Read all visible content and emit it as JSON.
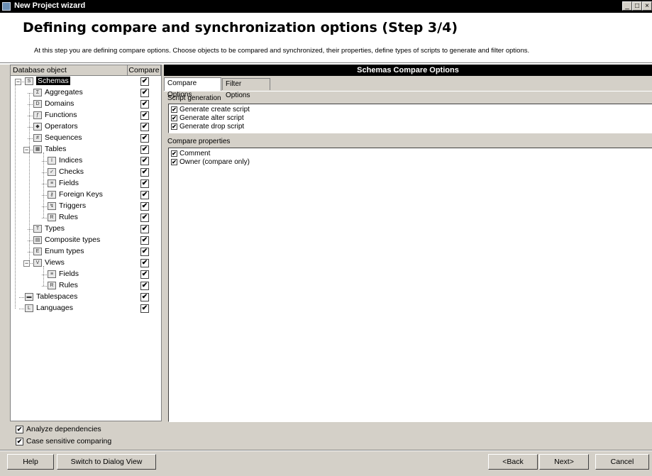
{
  "window": {
    "title": "New Project wizard",
    "controls": [
      "_",
      "□",
      "×"
    ]
  },
  "header": {
    "title": "Defining compare and synchronization options (Step 3/4)",
    "description": "At this step you are defining compare options. Choose objects to be compared and synchronized, their properties, define types of scripts to generate and filter options."
  },
  "tree": {
    "columns": {
      "object": "Database object",
      "compare": "Compare"
    },
    "items": [
      {
        "label": "Schemas",
        "icon": "schema-icon",
        "level": 0,
        "expander": "minus",
        "checked": true,
        "selected": true
      },
      {
        "label": "Aggregates",
        "icon": "aggregate-icon",
        "level": 1,
        "checked": true
      },
      {
        "label": "Domains",
        "icon": "domain-icon",
        "level": 1,
        "checked": true
      },
      {
        "label": "Functions",
        "icon": "function-icon",
        "level": 1,
        "checked": true
      },
      {
        "label": "Operators",
        "icon": "operator-icon",
        "level": 1,
        "checked": true
      },
      {
        "label": "Sequences",
        "icon": "sequence-icon",
        "level": 1,
        "checked": true
      },
      {
        "label": "Tables",
        "icon": "table-icon",
        "level": 1,
        "expander": "minus",
        "checked": true
      },
      {
        "label": "Indices",
        "icon": "index-icon",
        "level": 2,
        "checked": true
      },
      {
        "label": "Checks",
        "icon": "check-icon",
        "level": 2,
        "checked": true
      },
      {
        "label": "Fields",
        "icon": "field-icon",
        "level": 2,
        "checked": true
      },
      {
        "label": "Foreign Keys",
        "icon": "foreign-key-icon",
        "level": 2,
        "checked": true
      },
      {
        "label": "Triggers",
        "icon": "trigger-icon",
        "level": 2,
        "checked": true
      },
      {
        "label": "Rules",
        "icon": "rule-icon",
        "level": 2,
        "checked": true
      },
      {
        "label": "Types",
        "icon": "type-icon",
        "level": 1,
        "checked": true
      },
      {
        "label": "Composite types",
        "icon": "composite-type-icon",
        "level": 1,
        "checked": true
      },
      {
        "label": "Enum types",
        "icon": "enum-type-icon",
        "level": 1,
        "checked": true
      },
      {
        "label": "Views",
        "icon": "view-icon",
        "level": 1,
        "expander": "minus",
        "checked": true
      },
      {
        "label": "Fields",
        "icon": "field-icon",
        "level": 2,
        "checked": true
      },
      {
        "label": "Rules",
        "icon": "rule-icon",
        "level": 2,
        "checked": true
      },
      {
        "label": "Tablespaces",
        "icon": "tablespace-icon",
        "level": 0,
        "checked": true
      },
      {
        "label": "Languages",
        "icon": "language-icon",
        "level": 0,
        "checked": true
      }
    ]
  },
  "right_panel": {
    "title": "Schemas Compare Options",
    "tabs": [
      {
        "label": "Compare Options",
        "active": true
      },
      {
        "label": "Filter Options",
        "active": false
      }
    ],
    "script_generation": {
      "label": "Script generation",
      "items": [
        {
          "label": "Generate create script",
          "checked": true
        },
        {
          "label": "Generate alter script",
          "checked": true
        },
        {
          "label": "Generate drop script",
          "checked": true
        }
      ]
    },
    "compare_properties": {
      "label": "Compare properties",
      "items": [
        {
          "label": "Comment",
          "checked": true
        },
        {
          "label": "Owner (compare only)",
          "checked": true
        }
      ]
    }
  },
  "options": {
    "analyze_dependencies": {
      "label": "Analyze dependencies",
      "checked": true
    },
    "case_sensitive": {
      "label": "Case sensitive comparing",
      "checked": true
    }
  },
  "buttons": {
    "help": "Help",
    "switch_view": "Switch to Dialog View",
    "back": "<Back",
    "next": "Next>",
    "cancel": "Cancel"
  },
  "colors": {
    "selection": "#000000",
    "dialog_bg": "#d4d0c8",
    "panel_header_bg": "#000000"
  }
}
